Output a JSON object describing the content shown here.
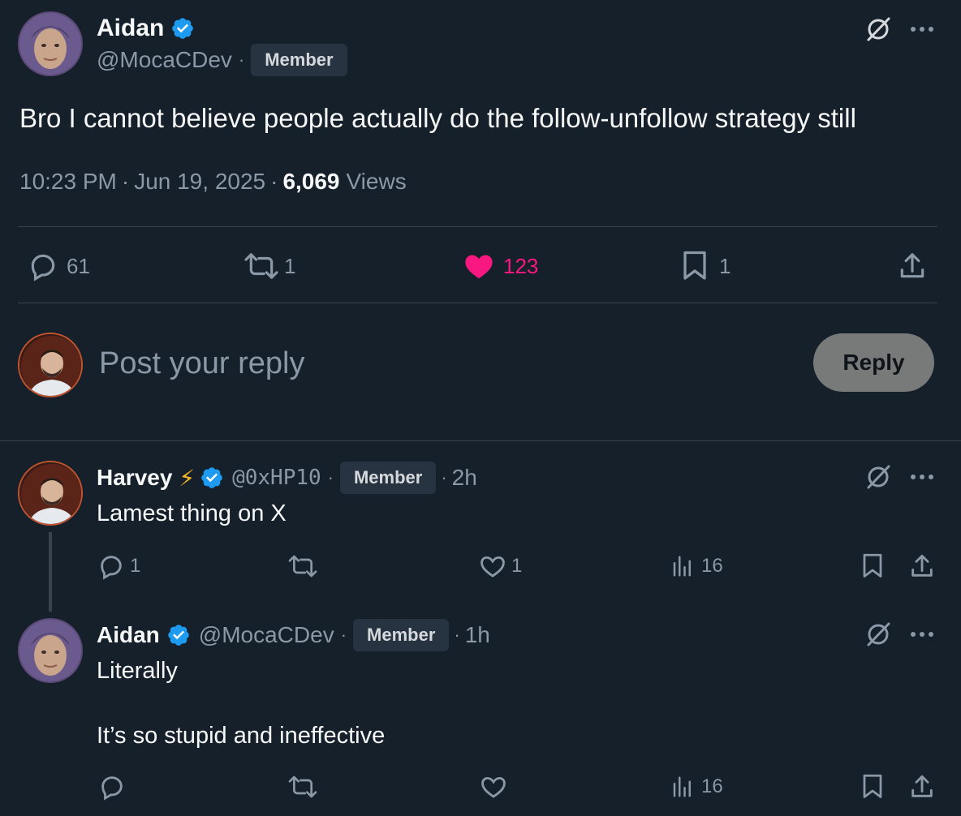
{
  "main_tweet": {
    "author_name": "Aidan",
    "handle": "@MocaCDev",
    "badge": "Member",
    "text": "Bro I cannot believe people actually do the follow-unfollow strategy still",
    "time": "10:23 PM",
    "date": "Jun 19, 2025",
    "views_count": "6,069",
    "views_label": "Views",
    "replies": "61",
    "reposts": "1",
    "likes": "123",
    "bookmarks": "1"
  },
  "reply_box": {
    "placeholder": "Post your reply",
    "button_label": "Reply"
  },
  "replies": [
    {
      "author_name": "Harvey",
      "emoji": "⚡",
      "handle": "@0xHP10",
      "badge": "Member",
      "age": "2h",
      "text": "Lamest thing on X",
      "replies": "1",
      "likes": "1",
      "views": "16"
    },
    {
      "author_name": "Aidan",
      "handle": "@MocaCDev",
      "badge": "Member",
      "age": "1h",
      "text_line1": "Literally",
      "text_line2": "It’s so stupid and ineffective",
      "views": "16"
    }
  ],
  "separator": "·",
  "colors": {
    "background": "#15202b",
    "verified": "#1d9bf0",
    "like": "#f91880",
    "muted": "#8b98a5"
  },
  "icons": [
    "verified-icon",
    "grok-icon",
    "more-icon",
    "reply-icon",
    "repost-icon",
    "like-icon",
    "bookmark-icon",
    "share-icon",
    "views-icon"
  ]
}
